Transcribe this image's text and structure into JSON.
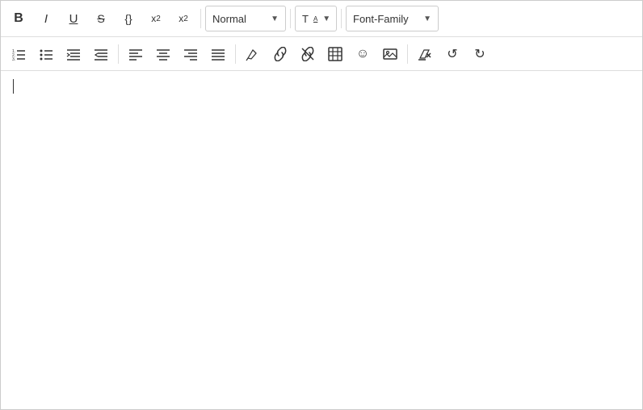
{
  "toolbar": {
    "row1": {
      "bold_label": "B",
      "italic_label": "I",
      "underline_label": "U",
      "strikethrough_label": "S",
      "code_label": "{}",
      "superscript_label": "x²",
      "subscript_label": "x₂",
      "normal_dropdown": "Normal",
      "text_dropdown": "T",
      "font_dropdown": "Font-Family"
    },
    "row2": {
      "ordered_list_label": "≡•",
      "unordered_list_label": "≡•",
      "indent_increase_label": "⇥≡",
      "indent_decrease_label": "≡⇤",
      "align_left_label": "≡",
      "align_center_label": "≡",
      "align_right_label": "≡",
      "align_justify_label": "≡",
      "marker_label": "✏",
      "link_label": "🔗",
      "unlink_label": "⛓",
      "table_label": "⊞",
      "emoji_label": "☺",
      "image_label": "🖼",
      "clear_label": "⊘",
      "undo_label": "↺",
      "redo_label": "↻"
    }
  },
  "editor": {
    "content": "",
    "placeholder": ""
  }
}
